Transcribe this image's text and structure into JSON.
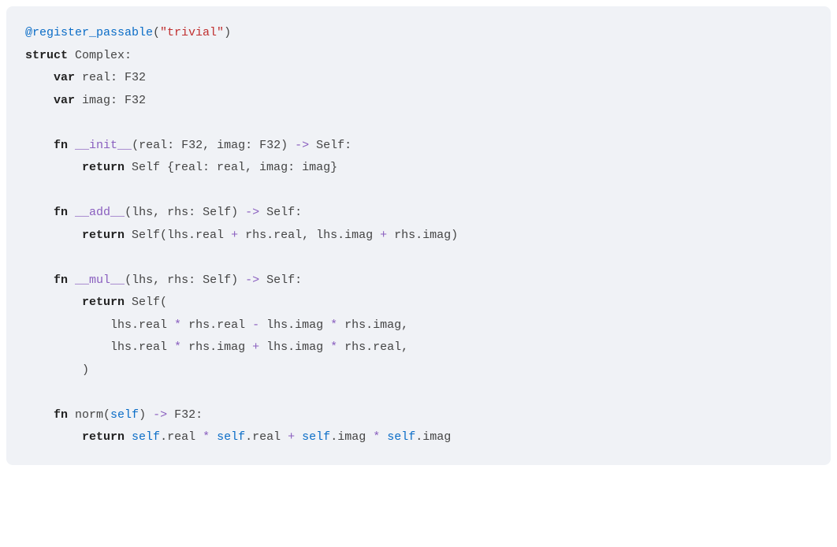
{
  "code": {
    "line1": {
      "decorator": "@register_passable",
      "paren_open": "(",
      "string": "\"trivial\"",
      "paren_close": ")"
    },
    "line2": {
      "kw_struct": "struct",
      "rest": " Complex:"
    },
    "line3": {
      "indent": "    ",
      "kw_var": "var",
      "rest": " real: F32"
    },
    "line4": {
      "indent": "    ",
      "kw_var": "var",
      "rest": " imag: F32"
    },
    "line6": {
      "indent": "    ",
      "kw_fn": "fn",
      "sp": " ",
      "dunder": "__init__",
      "params": "(real: F32, imag: F32) ",
      "arrow": "->",
      "ret": " Self:"
    },
    "line7": {
      "indent": "        ",
      "kw_return": "return",
      "rest": " Self {real: real, imag: imag}"
    },
    "line9": {
      "indent": "    ",
      "kw_fn": "fn",
      "sp": " ",
      "dunder": "__add__",
      "params": "(lhs, rhs: Self) ",
      "arrow": "->",
      "ret": " Self:"
    },
    "line10": {
      "indent": "        ",
      "kw_return": "return",
      "a": " Self(lhs.real ",
      "op1": "+",
      "b": " rhs.real, lhs.imag ",
      "op2": "+",
      "c": " rhs.imag)"
    },
    "line12": {
      "indent": "    ",
      "kw_fn": "fn",
      "sp": " ",
      "dunder": "__mul__",
      "params": "(lhs, rhs: Self) ",
      "arrow": "->",
      "ret": " Self:"
    },
    "line13": {
      "indent": "        ",
      "kw_return": "return",
      "rest": " Self("
    },
    "line14": {
      "indent": "            ",
      "a": "lhs.real ",
      "op1": "*",
      "b": " rhs.real ",
      "op2": "-",
      "c": " lhs.imag ",
      "op3": "*",
      "d": " rhs.imag,"
    },
    "line15": {
      "indent": "            ",
      "a": "lhs.real ",
      "op1": "*",
      "b": " rhs.imag ",
      "op2": "+",
      "c": " lhs.imag ",
      "op3": "*",
      "d": " rhs.real,"
    },
    "line16": {
      "indent": "        ",
      "rest": ")"
    },
    "line18": {
      "indent": "    ",
      "kw_fn": "fn",
      "sp": " norm(",
      "self": "self",
      "params": ") ",
      "arrow": "->",
      "ret": " F32:"
    },
    "line19": {
      "indent": "        ",
      "kw_return": "return",
      "sp": " ",
      "s1": "self",
      "a": ".real ",
      "op1": "*",
      "sp2": " ",
      "s2": "self",
      "b": ".real ",
      "op2": "+",
      "sp3": " ",
      "s3": "self",
      "c": ".imag ",
      "op3": "*",
      "sp4": " ",
      "s4": "self",
      "d": ".imag"
    }
  }
}
